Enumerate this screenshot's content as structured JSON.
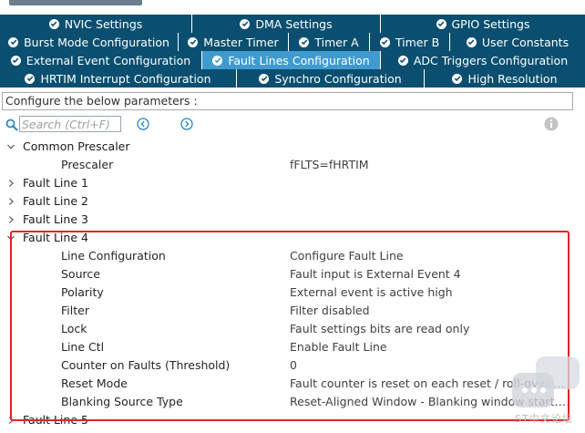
{
  "tabs": {
    "row1": [
      {
        "label": "NVIC Settings",
        "active": false
      },
      {
        "label": "DMA Settings",
        "active": false
      },
      {
        "label": "GPIO Settings",
        "active": false
      }
    ],
    "row2": [
      {
        "label": "Burst Mode Configuration",
        "active": false
      },
      {
        "label": "Master Timer",
        "active": false
      },
      {
        "label": "Timer A",
        "active": false
      },
      {
        "label": "Timer B",
        "active": false
      },
      {
        "label": "User Constants",
        "active": false
      }
    ],
    "row3": [
      {
        "label": "External Event Configuration",
        "active": false
      },
      {
        "label": "Fault Lines Configuration",
        "active": true
      },
      {
        "label": "ADC Triggers Configuration",
        "active": false
      }
    ],
    "row4": [
      {
        "label": "HRTIM Interrupt Configuration",
        "active": false
      },
      {
        "label": "Synchro Configuration",
        "active": false
      },
      {
        "label": "High Resolution",
        "active": false
      }
    ]
  },
  "config_header": "Configure the below parameters :",
  "search": {
    "placeholder": "Search (Ctrl+F)",
    "value": ""
  },
  "tree": {
    "common_prescaler": {
      "label": "Common Prescaler",
      "expanded": true,
      "params": [
        {
          "name": "Prescaler",
          "value": "fFLTS=fHRTIM"
        }
      ]
    },
    "fault_line_1": {
      "label": "Fault Line 1",
      "expanded": false
    },
    "fault_line_2": {
      "label": "Fault Line 2",
      "expanded": false
    },
    "fault_line_3": {
      "label": "Fault Line 3",
      "expanded": false
    },
    "fault_line_4": {
      "label": "Fault Line 4",
      "expanded": true,
      "params": [
        {
          "name": "Line Configuration",
          "value": "Configure Fault Line"
        },
        {
          "name": "Source",
          "value": "Fault input is External Event 4"
        },
        {
          "name": "Polarity",
          "value": "External event is active high"
        },
        {
          "name": "Filter",
          "value": "Filter disabled"
        },
        {
          "name": "Lock",
          "value": "Fault settings bits are read only"
        },
        {
          "name": "Line Ctl",
          "value": "Enable Fault Line"
        },
        {
          "name": "Counter on Faults (Threshold)",
          "value": "0"
        },
        {
          "name": "Reset Mode",
          "value": "Fault counter is reset on each reset / roll-over event"
        },
        {
          "name": "Blanking Source Type",
          "value": "Reset-Aligned Window - Blanking window starts on..."
        }
      ]
    },
    "fault_line_5": {
      "label": "Fault Line 5",
      "expanded": false
    }
  },
  "watermark_text": "ST中文论坛",
  "colors": {
    "tab_bg": "#0a4f70",
    "tab_active_bg": "#3f9bcf",
    "highlight_border": "#e32525"
  }
}
